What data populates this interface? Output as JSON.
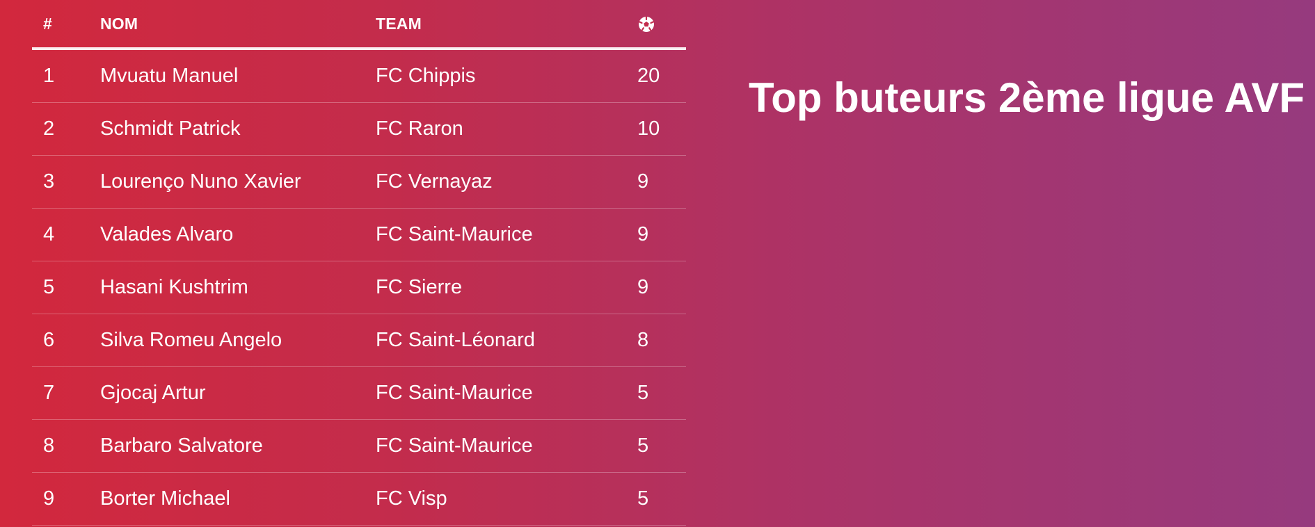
{
  "page": {
    "title": "Top buteurs 2ème ligue AVF"
  },
  "table": {
    "headers": {
      "rank": "#",
      "name": "NOM",
      "team": "TEAM",
      "goals_icon": "soccer-ball-icon"
    },
    "rows": [
      {
        "rank": "1",
        "name": "Mvuatu Manuel",
        "team": "FC Chippis",
        "goals": "20"
      },
      {
        "rank": "2",
        "name": "Schmidt Patrick",
        "team": "FC Raron",
        "goals": "10"
      },
      {
        "rank": "3",
        "name": "Lourenço Nuno Xavier",
        "team": "FC Vernayaz",
        "goals": "9"
      },
      {
        "rank": "4",
        "name": "Valades Alvaro",
        "team": "FC Saint-Maurice",
        "goals": "9"
      },
      {
        "rank": "5",
        "name": "Hasani Kushtrim",
        "team": "FC Sierre",
        "goals": "9"
      },
      {
        "rank": "6",
        "name": "Silva Romeu Angelo",
        "team": "FC Saint-Léonard",
        "goals": "8"
      },
      {
        "rank": "7",
        "name": "Gjocaj Artur",
        "team": "FC Saint-Maurice",
        "goals": "5"
      },
      {
        "rank": "8",
        "name": "Barbaro Salvatore",
        "team": "FC Saint-Maurice",
        "goals": "5"
      },
      {
        "rank": "9",
        "name": "Borter Michael",
        "team": "FC Visp",
        "goals": "5"
      }
    ]
  },
  "colors": {
    "gradient_start": "#d2283d",
    "gradient_end": "#963a7e",
    "text": "#ffffff"
  }
}
